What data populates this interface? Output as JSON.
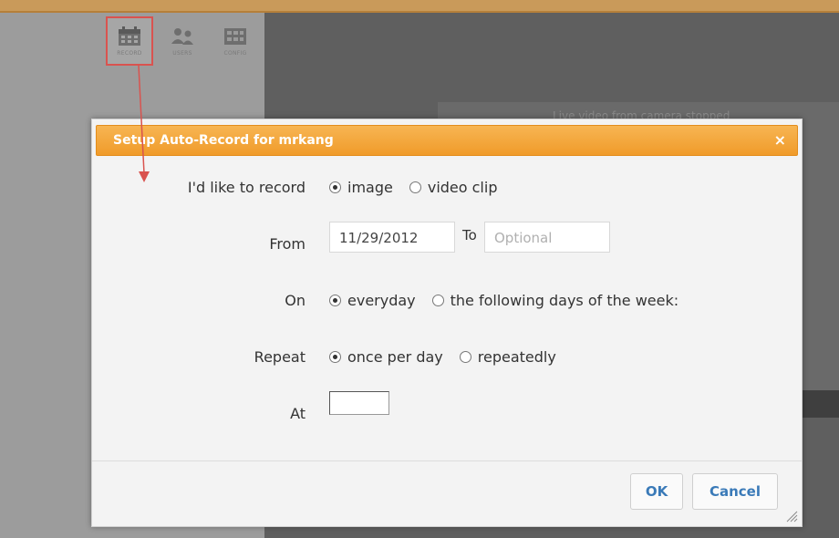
{
  "toolbar": {
    "items": [
      {
        "label": "RECORD",
        "icon": "calendar-icon"
      },
      {
        "label": "USERS",
        "icon": "users-icon"
      },
      {
        "label": "CONFIG",
        "icon": "config-icon"
      }
    ]
  },
  "background": {
    "status_text": "Live video from camera stopped"
  },
  "dialog": {
    "title": "Setup Auto-Record for mrkang",
    "close_glyph": "×",
    "record": {
      "label": "I'd like to record",
      "options": [
        "image",
        "video clip"
      ],
      "selected": "image"
    },
    "from": {
      "label": "From",
      "value": "11/29/2012",
      "to_label": "To",
      "to_placeholder": "Optional"
    },
    "on": {
      "label": "On",
      "options": [
        "everyday",
        "the following days of the week:"
      ],
      "selected": "everyday"
    },
    "repeat": {
      "label": "Repeat",
      "options": [
        "once per day",
        "repeatedly"
      ],
      "selected": "once per day"
    },
    "at": {
      "label": "At",
      "value": ""
    },
    "ok_label": "OK",
    "cancel_label": "Cancel"
  },
  "colors": {
    "title_bar": "#f09b2a",
    "annotation": "#d9534f",
    "button_text": "#3a7ab8"
  }
}
